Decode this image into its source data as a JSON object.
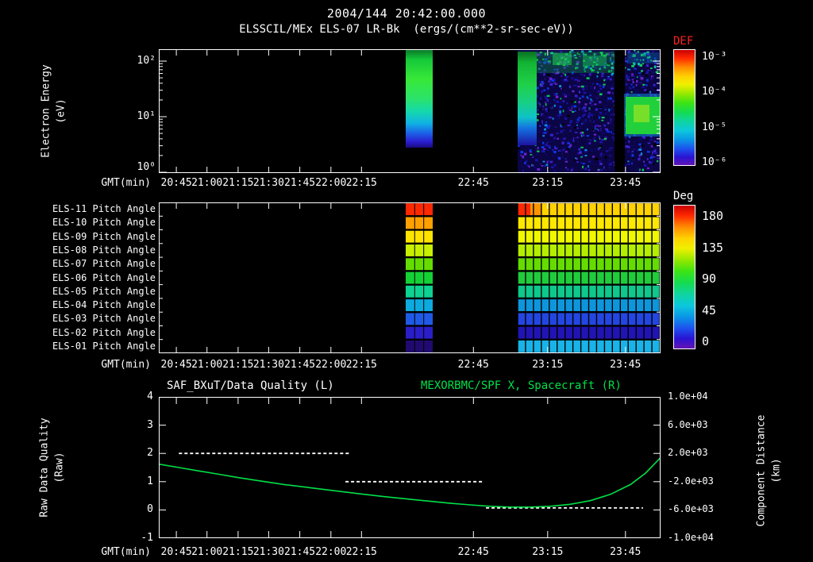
{
  "header": {
    "title": "2004/144 20:42:00.000",
    "subtitle": "ELSSCIL/MEx ELS-07 LR-Bk  (ergs/(cm**2-sr-sec-eV))"
  },
  "axes": {
    "gmt_label": "GMT(min)",
    "x_ticks": [
      {
        "label": "20:45",
        "f": 0.035
      },
      {
        "label": "21:00",
        "f": 0.096
      },
      {
        "label": "21:15",
        "f": 0.158
      },
      {
        "label": "21:30",
        "f": 0.219
      },
      {
        "label": "21:45",
        "f": 0.281
      },
      {
        "label": "22:00",
        "f": 0.343
      },
      {
        "label": "22:15",
        "f": 0.404
      },
      {
        "label": "22:45",
        "f": 0.627
      },
      {
        "label": "23:15",
        "f": 0.775
      },
      {
        "label": "23:45",
        "f": 0.93
      }
    ]
  },
  "panel1": {
    "ylabel_lines": [
      "Electron Energy",
      "(eV)"
    ],
    "y_tick_labels": [
      "10²",
      "10¹",
      "10⁰"
    ]
  },
  "def_bar": {
    "label": "DEF",
    "label_color": "#ff2020",
    "ticks": [
      "10⁻³",
      "10⁻⁴",
      "10⁻⁵",
      "10⁻⁶"
    ]
  },
  "deg_bar": {
    "label": "Deg",
    "label_color": "#ffffff",
    "ticks": [
      "180",
      "135",
      "90",
      "45",
      "0"
    ]
  },
  "panel2": {
    "row_labels": [
      "ELS-11 Pitch Angle",
      "ELS-10 Pitch Angle",
      "ELS-09 Pitch Angle",
      "ELS-08 Pitch Angle",
      "ELS-07 Pitch Angle",
      "ELS-06 Pitch Angle",
      "ELS-05 Pitch Angle",
      "ELS-04 Pitch Angle",
      "ELS-03 Pitch Angle",
      "ELS-02 Pitch Angle",
      "ELS-01 Pitch Angle"
    ],
    "row_colors_band": [
      "#ff2800",
      "#ffa000",
      "#ffe400",
      "#c8f000",
      "#64dc00",
      "#14d235",
      "#0ed292",
      "#0caade",
      "#1e5ae6",
      "#2a1ec8",
      "#200a70"
    ],
    "row_colors_wide": [
      "#ffd200",
      "#ffe800",
      "#f0f800",
      "#b4ee00",
      "#64dc00",
      "#20cc3c",
      "#0ec88c",
      "#0c96dc",
      "#2346e0",
      "#2114b4",
      "#18b4e8"
    ]
  },
  "panel3": {
    "title_left": "SAF_BXuT/Data Quality (L)",
    "title_left_color": "#ffffff",
    "title_right": "MEXORBMC/SPF X, Spacecraft (R)",
    "title_right_color": "#00e048",
    "left_ticks": [
      "4",
      "3",
      "2",
      "1",
      "0",
      "-1"
    ],
    "right_ticks": [
      "1.0e+04",
      "6.0e+03",
      "2.0e+03",
      "-2.0e+03",
      "-6.0e+03",
      "-1.0e+04"
    ],
    "ylabel_left_lines": [
      "Raw Data Quality",
      "(Raw)"
    ],
    "ylabel_right_lines": [
      "Component Distance",
      "(km)"
    ]
  },
  "chart_data": [
    {
      "type": "heatmap",
      "title": "ELSSCIL/MEx ELS-07 LR-Bk",
      "units": "ergs/(cm**2-sr-sec-eV)",
      "xlabel": "GMT(min)",
      "x_ticklabels": [
        "20:45",
        "21:00",
        "21:15",
        "21:30",
        "21:45",
        "22:00",
        "22:15",
        "22:45",
        "23:15",
        "23:45"
      ],
      "ylabel": "Electron Energy (eV)",
      "yscale": "log",
      "ylim": [
        1,
        200
      ],
      "colorbar": {
        "label": "DEF",
        "ticks": [
          "10⁻³",
          "10⁻⁴",
          "10⁻⁵",
          "10⁻⁶"
        ],
        "orientation": "vertical"
      },
      "regions": [
        {
          "x_frac": [
            0.494,
            0.548
          ],
          "energy_ev": [
            3,
            200
          ],
          "desc": "bright green-to-cyan column, flux ~1e-4"
        },
        {
          "x_frac": [
            0.715,
            0.755
          ],
          "energy_ev": [
            3,
            200
          ],
          "desc": "green-cyan band"
        },
        {
          "x_frac": [
            0.755,
            0.905
          ],
          "energy_ev": [
            1,
            200
          ],
          "desc": "blue-purple speckle ~1e-6 with green patches near 30-100 eV"
        },
        {
          "x_frac": [
            0.93,
            1.0
          ],
          "energy_ev": [
            8,
            60
          ],
          "desc": "green patch ~1e-4"
        }
      ]
    },
    {
      "type": "heatmap",
      "rows": [
        "ELS-11",
        "ELS-10",
        "ELS-09",
        "ELS-08",
        "ELS-07",
        "ELS-06",
        "ELS-05",
        "ELS-04",
        "ELS-03",
        "ELS-02",
        "ELS-01"
      ],
      "ylabel": "Pitch Angle",
      "colorbar": {
        "label": "Deg",
        "ticks": [
          180,
          135,
          90,
          45,
          0
        ],
        "orientation": "vertical"
      },
      "row_values_deg": [
        180,
        162,
        144,
        126,
        108,
        90,
        72,
        54,
        36,
        18,
        5
      ],
      "regions": [
        {
          "x_frac": [
            0.494,
            0.548
          ],
          "desc": "narrow column, rainbow red(top) to dark blue(bottom)"
        },
        {
          "x_frac": [
            0.715,
            1.0
          ],
          "desc": "gridded block; ELS-11 red/orange at left edge then yellow; bottom row cyan"
        }
      ]
    },
    {
      "type": "line",
      "title_left": "SAF_BXuT/Data Quality (L)",
      "title_right": "MEXORBMC/SPF X, Spacecraft (R)",
      "xlabel": "GMT(min)",
      "ylabel_left": "Raw Data Quality (Raw)",
      "ylabel_right": "Component Distance (km)",
      "ylim_left": [
        -1,
        4
      ],
      "ylim_right": [
        -10000,
        10000
      ],
      "series": [
        {
          "name": "MEXORBMC/SPF X, Spacecraft (R)",
          "axis": "right",
          "color": "#00e048",
          "style": "solid",
          "x_frac": [
            0.0,
            0.04,
            0.08,
            0.12,
            0.16,
            0.2,
            0.25,
            0.3,
            0.35,
            0.4,
            0.45,
            0.5,
            0.55,
            0.58,
            0.62,
            0.66,
            0.7,
            0.74,
            0.78,
            0.82,
            0.86,
            0.9,
            0.94,
            0.97,
            1.0
          ],
          "y_raw": [
            1.62,
            1.5,
            1.38,
            1.26,
            1.14,
            1.03,
            0.9,
            0.79,
            0.68,
            0.57,
            0.47,
            0.38,
            0.29,
            0.24,
            0.18,
            0.13,
            0.1,
            0.1,
            0.13,
            0.2,
            0.33,
            0.55,
            0.9,
            1.3,
            1.85
          ]
        },
        {
          "name": "SAF_BXuT/Data Quality (L)",
          "axis": "left",
          "color": "#ffffff",
          "style": "dashed",
          "segments": [
            {
              "y": 2.0,
              "x_frac": [
                0.04,
                0.38
              ]
            },
            {
              "y": 1.0,
              "x_frac": [
                0.372,
                0.645
              ]
            },
            {
              "y": 0.07,
              "x_frac": [
                0.652,
                0.965
              ]
            }
          ]
        }
      ]
    }
  ]
}
